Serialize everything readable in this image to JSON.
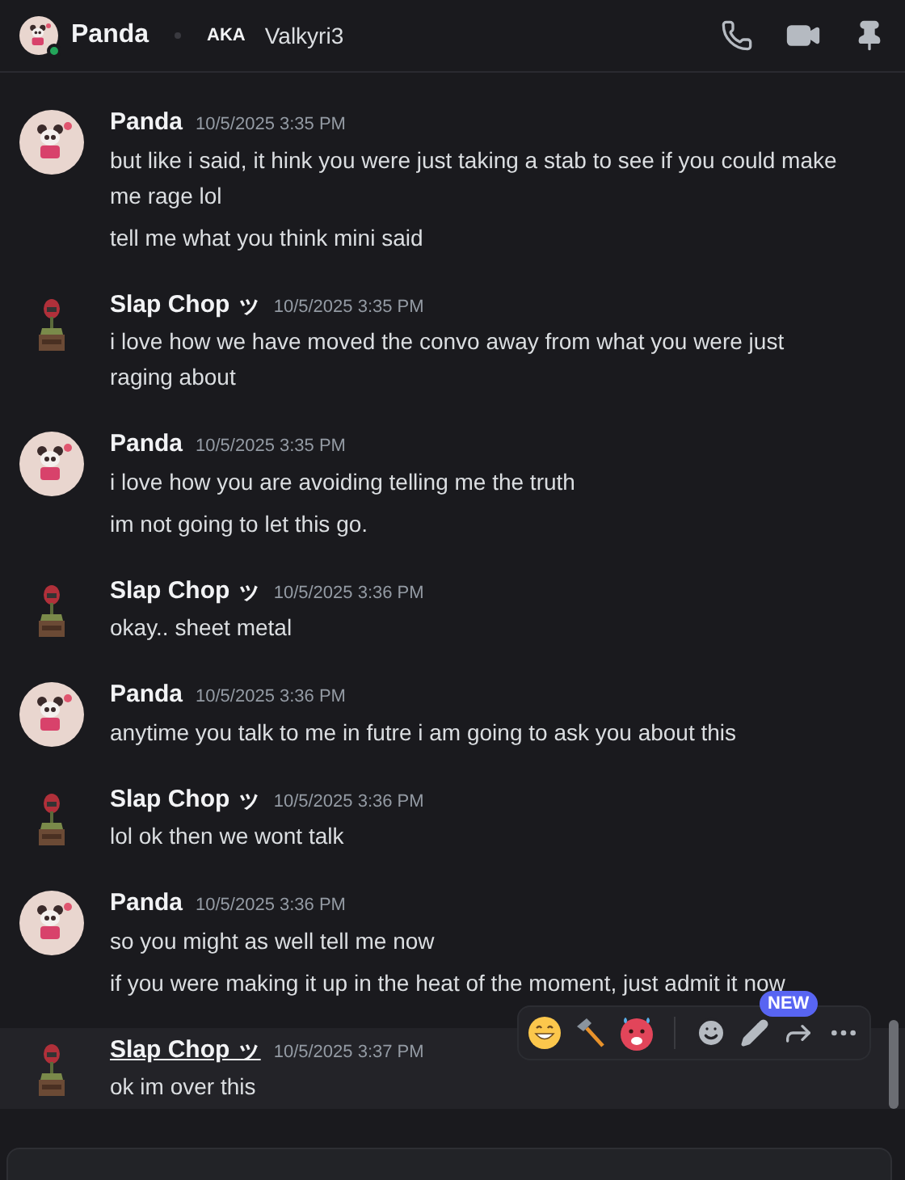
{
  "header": {
    "name": "Panda",
    "online": true,
    "aka_label": "AKA",
    "aka_name": "Valkyri3"
  },
  "messages": [
    {
      "kind": "panda",
      "author": "Panda",
      "time": "10/5/2025 3:35 PM",
      "hovered": false,
      "lines": [
        "but like i said, it hink you were just taking a stab to see if you could make me rage lol",
        "tell me what you think mini said"
      ]
    },
    {
      "kind": "robot",
      "author": "Slap Chop ッ",
      "time": "10/5/2025 3:35 PM",
      "hovered": false,
      "lines": [
        "i love how we have moved the convo away from what you were just raging about"
      ]
    },
    {
      "kind": "panda",
      "author": "Panda",
      "time": "10/5/2025 3:35 PM",
      "hovered": false,
      "lines": [
        "i love how you are avoiding telling me the truth",
        "im not going to let this go."
      ]
    },
    {
      "kind": "robot",
      "author": "Slap Chop ッ",
      "time": "10/5/2025 3:36 PM",
      "hovered": false,
      "lines": [
        "okay.. sheet metal"
      ]
    },
    {
      "kind": "panda",
      "author": "Panda",
      "time": "10/5/2025 3:36 PM",
      "hovered": false,
      "lines": [
        "anytime you talk to me in futre i am going to ask you about this"
      ]
    },
    {
      "kind": "robot",
      "author": "Slap Chop ッ",
      "time": "10/5/2025 3:36 PM",
      "hovered": false,
      "lines": [
        "lol ok then we wont talk"
      ]
    },
    {
      "kind": "panda",
      "author": "Panda",
      "time": "10/5/2025 3:36 PM",
      "hovered": false,
      "lines": [
        "so you might as well tell me now",
        "if you were making it up in the heat of the moment, just admit it now"
      ]
    },
    {
      "kind": "robot",
      "author": "Slap Chop ッ",
      "time": "10/5/2025 3:37 PM",
      "hovered": true,
      "lines": [
        "ok im over this"
      ]
    }
  ],
  "hover_toolbar": {
    "new_badge": "NEW"
  }
}
